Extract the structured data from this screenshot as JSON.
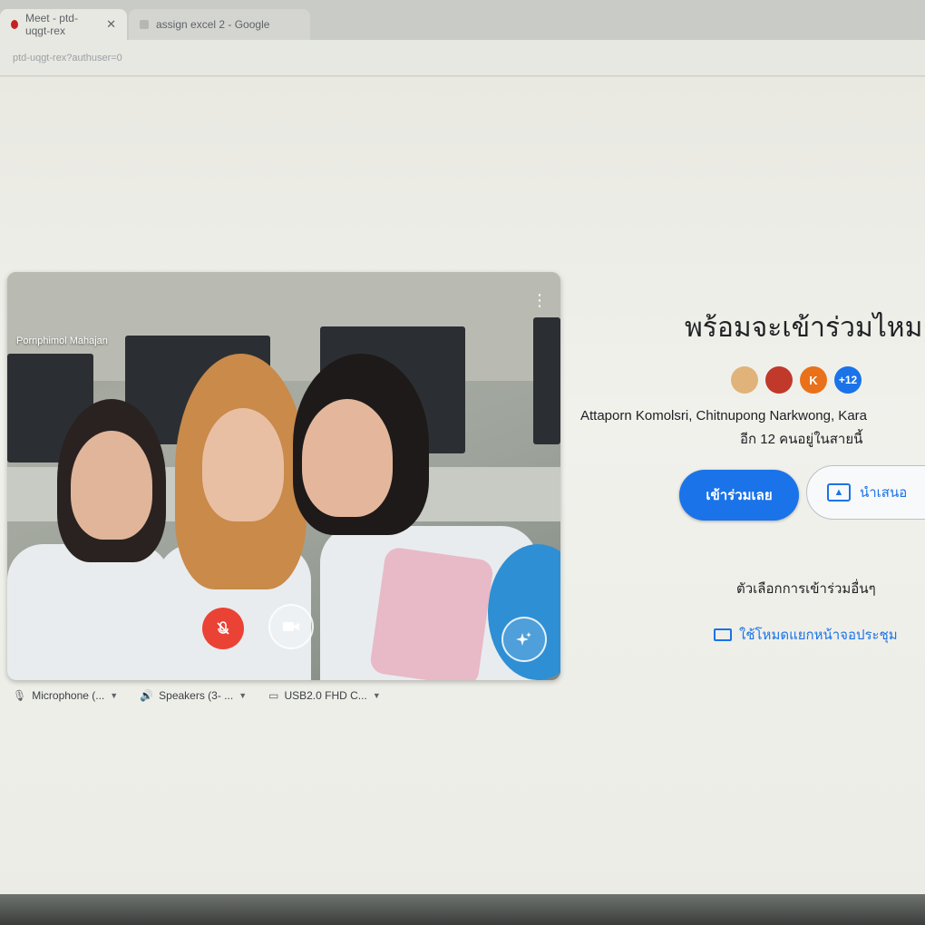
{
  "browser": {
    "tabs": [
      {
        "label": "Meet - ptd-uqgt-rex",
        "active": true
      },
      {
        "label": "assign excel 2 - Google",
        "active": false
      }
    ],
    "url": "ptd-uqgt-rex?authuser=0"
  },
  "preview": {
    "participant_name": "Pornphimol Mahajan",
    "mic_muted": true,
    "colors": {
      "mic_off": "#ea4335"
    }
  },
  "devices": {
    "microphone": "Microphone (...",
    "speakers": "Speakers (3- ...",
    "camera": "USB2.0 FHD C..."
  },
  "join_panel": {
    "title": "พร้อมจะเข้าร่วมไหม",
    "avatars": [
      {
        "letter": ""
      },
      {
        "letter": ""
      },
      {
        "letter": "K"
      }
    ],
    "more_count": "+12",
    "names": "Attaporn Komolsri, Chitnupong Narkwong, Kara",
    "others_text": "อีก 12 คนอยู่ในสายนี้",
    "join_button": "เข้าร่วมเลย",
    "present_button": "นำเสนอ",
    "other_options": "ตัวเลือกการเข้าร่วมอื่นๆ",
    "companion_mode": "ใช้โหมดแยกหน้าจอประชุม",
    "colors": {
      "accent": "#1a73e8"
    }
  }
}
